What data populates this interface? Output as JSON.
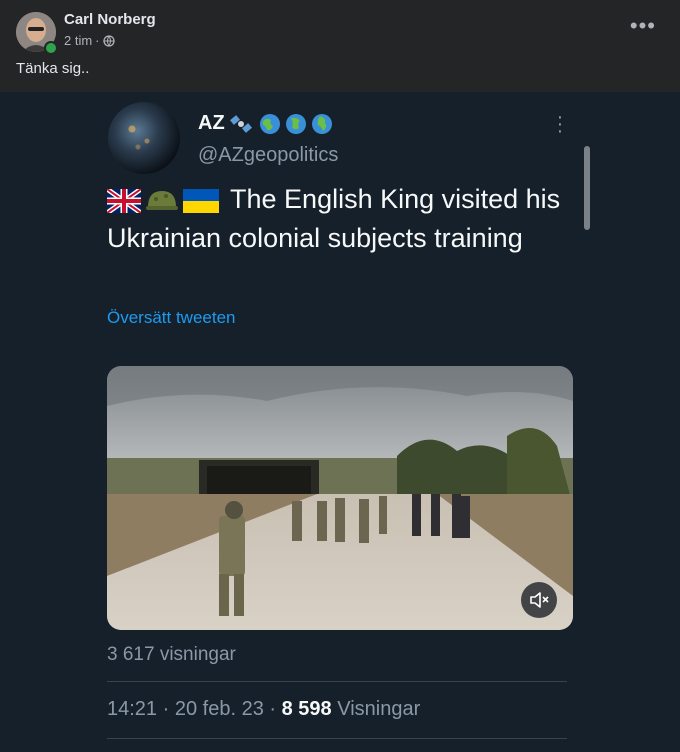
{
  "post": {
    "author": "Carl Norberg",
    "time": "2 tim",
    "dot": "·",
    "more": "•••",
    "text": "Tänka sig.."
  },
  "tweet": {
    "name": "AZ",
    "name_emojis": [
      "satellite-emoji",
      "globe-emoji",
      "globe-emoji",
      "globe-emoji"
    ],
    "handle": "@AZgeopolitics",
    "body": "The English King visited his Ukrainian colonial subjects training",
    "body_emojis": [
      "uk-flag-emoji",
      "military-helmet-emoji",
      "ukraine-flag-emoji"
    ],
    "translate": "Översätt tweeten",
    "video_views": "3 617 visningar",
    "time": "14:21",
    "sep1": "·",
    "date": "20 feb. 23",
    "sep2": "·",
    "views_count": "8 598",
    "views_label": "Visningar"
  },
  "colors": {
    "facebook_bg": "#242526",
    "twitter_bg": "#15202b",
    "link": "#1d9bf0",
    "online": "#31a24c"
  }
}
